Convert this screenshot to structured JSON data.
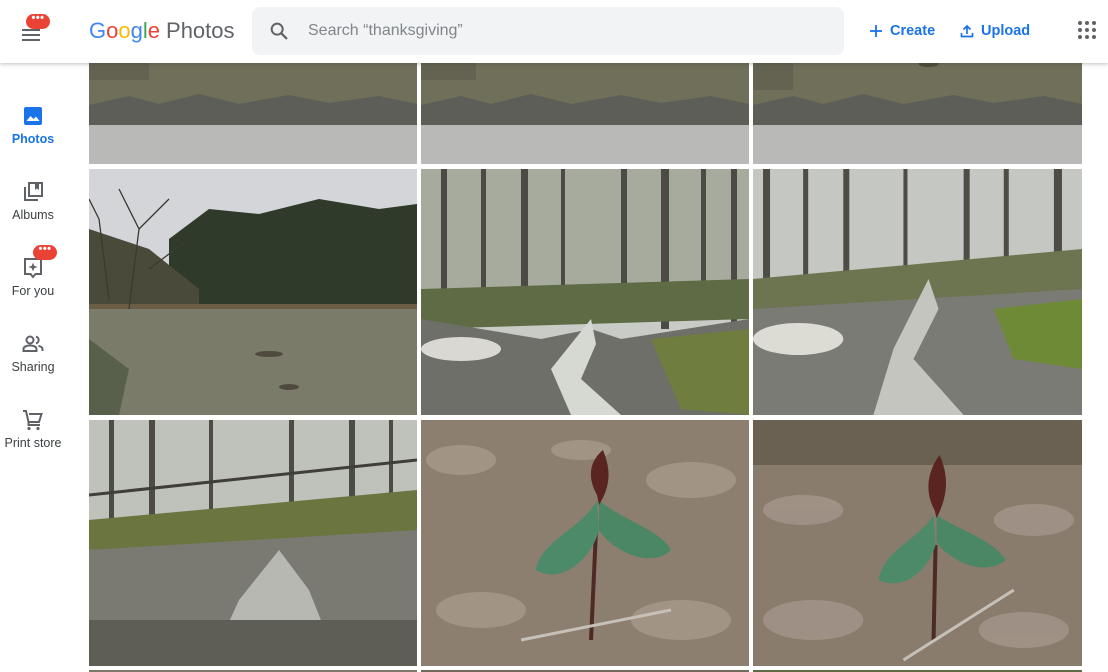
{
  "header": {
    "menu_badge": "•••",
    "logo": {
      "google": [
        "G",
        "o",
        "o",
        "g",
        "l",
        "e"
      ],
      "product": "Photos"
    },
    "search": {
      "placeholder": "Search “thanksgiving”",
      "value": ""
    },
    "actions": {
      "create": "Create",
      "upload": "Upload"
    }
  },
  "sidebar": {
    "items": [
      {
        "id": "photos",
        "label": "Photos",
        "icon": "photo-icon",
        "active": true
      },
      {
        "id": "albums",
        "label": "Albums",
        "icon": "albums-icon",
        "active": false
      },
      {
        "id": "for-you",
        "label": "For you",
        "icon": "for-you-icon",
        "active": false,
        "badge": "•••"
      },
      {
        "id": "sharing",
        "label": "Sharing",
        "icon": "sharing-icon",
        "active": false
      },
      {
        "id": "print-store",
        "label": "Print store",
        "icon": "cart-icon",
        "active": false
      }
    ]
  },
  "photos": [
    {
      "row": 0,
      "col": 0,
      "subject": "lake-reflection"
    },
    {
      "row": 0,
      "col": 1,
      "subject": "lake-reflection"
    },
    {
      "row": 0,
      "col": 2,
      "subject": "lake-reflection"
    },
    {
      "row": 1,
      "col": 0,
      "subject": "lake-with-forest"
    },
    {
      "row": 1,
      "col": 1,
      "subject": "forest-creek-waterfall"
    },
    {
      "row": 1,
      "col": 2,
      "subject": "forest-creek-waterfall"
    },
    {
      "row": 2,
      "col": 0,
      "subject": "creek-low-angle"
    },
    {
      "row": 2,
      "col": 1,
      "subject": "trillium-flower"
    },
    {
      "row": 2,
      "col": 2,
      "subject": "trillium-flower"
    },
    {
      "row": 3,
      "col": 0,
      "subject": "partial"
    },
    {
      "row": 3,
      "col": 1,
      "subject": "partial"
    },
    {
      "row": 3,
      "col": 2,
      "subject": "partial"
    }
  ],
  "colors": {
    "accent": "#1a73e8",
    "badge": "#ea4335",
    "search_bg": "#f1f3f4",
    "icon_gray": "#5f6368"
  }
}
